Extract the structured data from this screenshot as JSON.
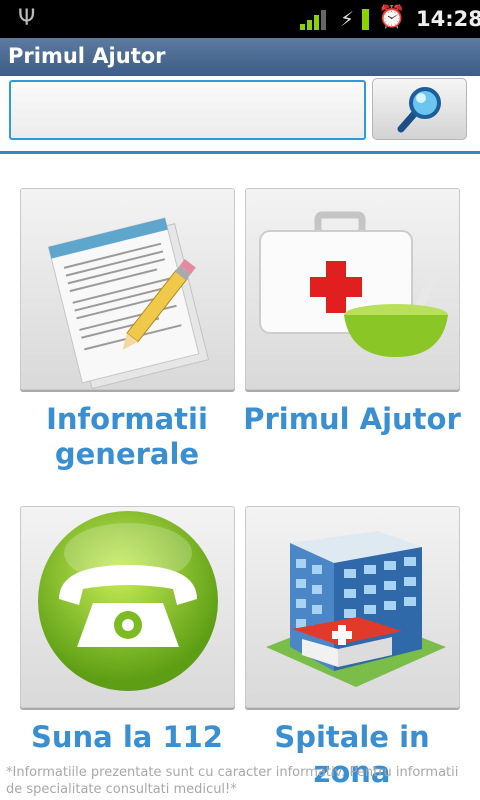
{
  "status_bar": {
    "time": "14:28",
    "icons": [
      "usb-icon",
      "signal-icon",
      "charging-icon",
      "battery-icon",
      "alarm-icon"
    ]
  },
  "app": {
    "title": "Primul Ajutor"
  },
  "search": {
    "value": "",
    "placeholder": "",
    "button_icon": "search-icon"
  },
  "tiles": [
    {
      "label_line1": "Informatii",
      "label_line2": "generale",
      "icon": "documents-icon"
    },
    {
      "label": "Primul Ajutor",
      "icon": "first-aid-kit-icon"
    },
    {
      "label": "Suna la 112",
      "icon": "phone-icon"
    },
    {
      "label": "Spitale in zona",
      "icon": "hospital-icon"
    }
  ],
  "footer": {
    "note": "*Informatiile prezentate sunt cu caracter informativ. Pentru informatii de specialitate consultati medicul!*"
  },
  "colors": {
    "accent": "#3a8fd3",
    "title_bar": "#4a6a94",
    "footer_text": "#a8a8a8"
  }
}
